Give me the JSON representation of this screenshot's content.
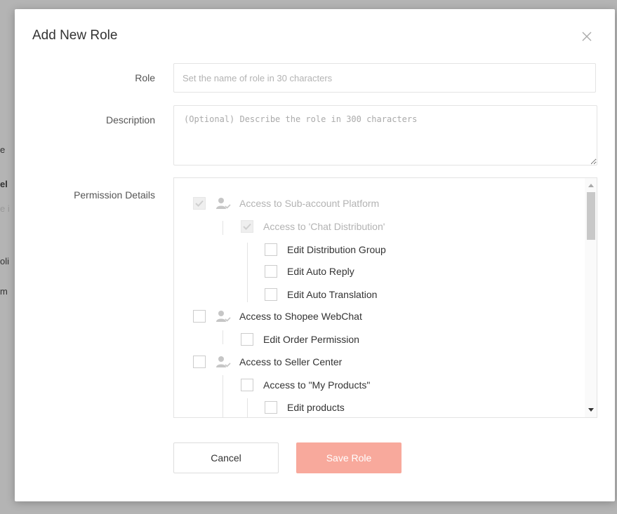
{
  "modal": {
    "title": "Add New Role",
    "role_label": "Role",
    "role_placeholder": "Set the name of role in 30 characters",
    "description_label": "Description",
    "description_placeholder": "(Optional) Describe the role in 300 characters",
    "permission_label": "Permission Details",
    "cancel_label": "Cancel",
    "save_label": "Save Role"
  },
  "backdrop": [
    "e",
    "el",
    "e i",
    "oli",
    "m"
  ],
  "permissions": [
    {
      "label": "Access to Sub-account Platform",
      "level": 0,
      "state": "checked-disabled",
      "icon": "user-check-icon"
    },
    {
      "label": "Access to 'Chat Distribution'",
      "level": 1,
      "state": "checked-disabled"
    },
    {
      "label": "Edit Distribution Group",
      "level": 2,
      "state": "unchecked"
    },
    {
      "label": "Edit Auto Reply",
      "level": 2,
      "state": "unchecked"
    },
    {
      "label": "Edit Auto Translation",
      "level": 2,
      "state": "unchecked"
    },
    {
      "label": "Access to Shopee WebChat",
      "level": 0,
      "state": "unchecked",
      "icon": "user-check-icon"
    },
    {
      "label": "Edit Order Permission",
      "level": 1,
      "state": "unchecked"
    },
    {
      "label": "Access to Seller Center",
      "level": 0,
      "state": "unchecked",
      "icon": "user-check-icon"
    },
    {
      "label": "Access to \"My Products\"",
      "level": 1,
      "state": "unchecked"
    },
    {
      "label": "Edit products",
      "level": 2,
      "state": "unchecked"
    }
  ],
  "colors": {
    "save_button": "#f8a99c",
    "backdrop": "#b4b4b4"
  }
}
